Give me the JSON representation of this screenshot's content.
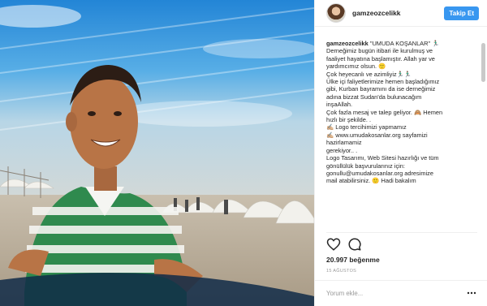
{
  "post": {
    "username": "gamzeozcelikk",
    "follow_label": "Takip Et",
    "caption_user": "gamzeozcelikk",
    "caption_lines": [
      "\"UMUDA KOŞANLAR\" 🏃🏽‍♂️",
      "Derneğimiz bugün itibari ile kurulmuş ve",
      "faaliyet hayatına başlamıştır. Allah yar ve",
      "yardımcımız olsun. 🙂",
      "Çok heyecanlı ve azimliyiz🏃🏽‍♂️🏃🏽‍♂️",
      "Ülke içi faliyetlerimize hemen başladığımız",
      "gibi, Kurban bayramını da ise derneğimiz",
      "adına bizzat Sudan'da bulunacağım",
      "inşaAllah.",
      "Çok fazla mesaj ve talep geliyor. 🙈 Hemen",
      "hızlı bir şekilde. .",
      "✍🏼 Logo tercihimizi yapmamız",
      "✍🏼 www.umudakosanlar.org sayfamizi",
      "hazirlamamiz",
      "gerekiyor.. .",
      "Logo Tasarımı, Web Sitesi hazırlığı ve tüm",
      "gönüllülük başvurularınız için:",
      "gonullu@umudakosanlar.org adresimize",
      "mail atabilirsiniz. 🙂 Hadi bakalım"
    ],
    "likes": "20.997 beğenme",
    "date": "15 AĞUSTOS",
    "comment_placeholder": "Yorum ekle...",
    "icons": {
      "like": "heart-icon",
      "comment": "comment-bubble-icon",
      "more": "more-options-icon"
    },
    "colors": {
      "follow_button": "#3897f0",
      "text": "#262626",
      "muted": "#999999"
    }
  }
}
